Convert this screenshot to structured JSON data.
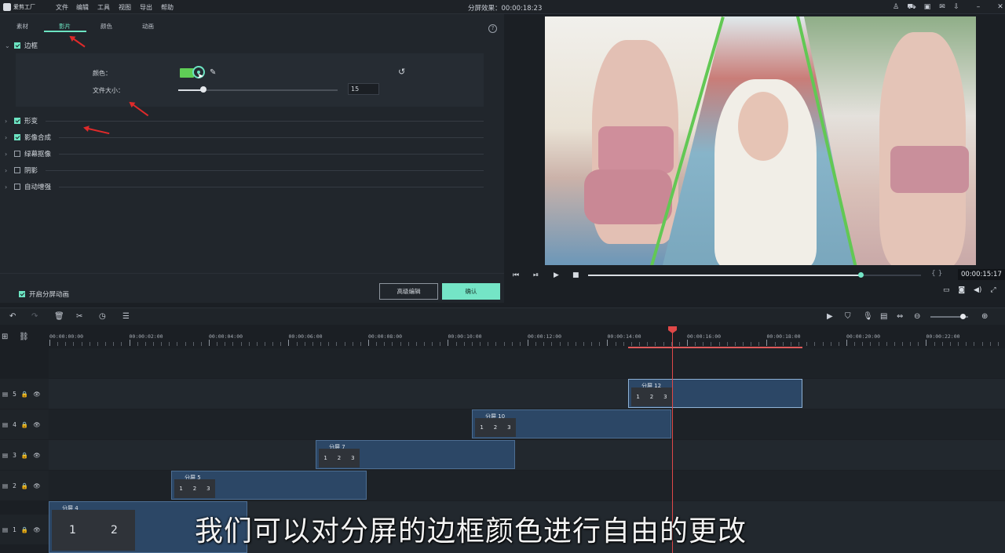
{
  "app": {
    "logo_text": "爱剪工厂",
    "title": "分屏效果：00:00:18:23"
  },
  "menu": [
    "文件",
    "编辑",
    "工具",
    "视图",
    "导出",
    "帮助"
  ],
  "tabs": [
    "素材",
    "影片",
    "颜色",
    "动画"
  ],
  "sections": {
    "border": "边框",
    "deform": "形变",
    "composite": "影像合成",
    "greenscreen": "绿幕抠像",
    "shadow": "阴影",
    "auto_enhance": "自动增强"
  },
  "border_panel": {
    "color_label": "颜色：",
    "size_label": "文件大小：",
    "size_value": "15",
    "color": "#5fce56",
    "size_fraction": 0.15
  },
  "footer": {
    "split_anim_label": "开启分屏动画",
    "advanced_label": "高级编辑",
    "confirm_label": "确认"
  },
  "player": {
    "time": "00:00:15:17",
    "progress": 0.82
  },
  "ruler_labels": [
    "00:00:00:00",
    "00:00:02:00",
    "00:00:04:00",
    "00:00:06:00",
    "00:00:08:00",
    "00:00:10:00",
    "00:00:12:00",
    "00:00:14:00",
    "00:00:16:00",
    "00:00:18:00",
    "00:00:20:00",
    "00:00:22:00"
  ],
  "tracks": [
    "5",
    "4",
    "3",
    "2",
    "1"
  ],
  "clips": [
    {
      "title": "分屏 12",
      "cells": [
        "1",
        "2",
        "3"
      ]
    },
    {
      "title": "分屏 10",
      "cells": [
        "1",
        "2",
        "3"
      ]
    },
    {
      "title": "分屏 7",
      "cells": [
        "1",
        "2",
        "3"
      ]
    },
    {
      "title": "分屏 5",
      "cells": [
        "1",
        "2",
        "3"
      ]
    },
    {
      "title": "分屏 4",
      "cells": [
        "1",
        "2"
      ]
    }
  ],
  "subtitle": "我们可以对分屏的边框颜色进行自由的更改",
  "colors": {
    "accent": "#6ce4c2",
    "border_green": "#62c854",
    "playhead": "#e04848",
    "clip": "#2c4766"
  }
}
